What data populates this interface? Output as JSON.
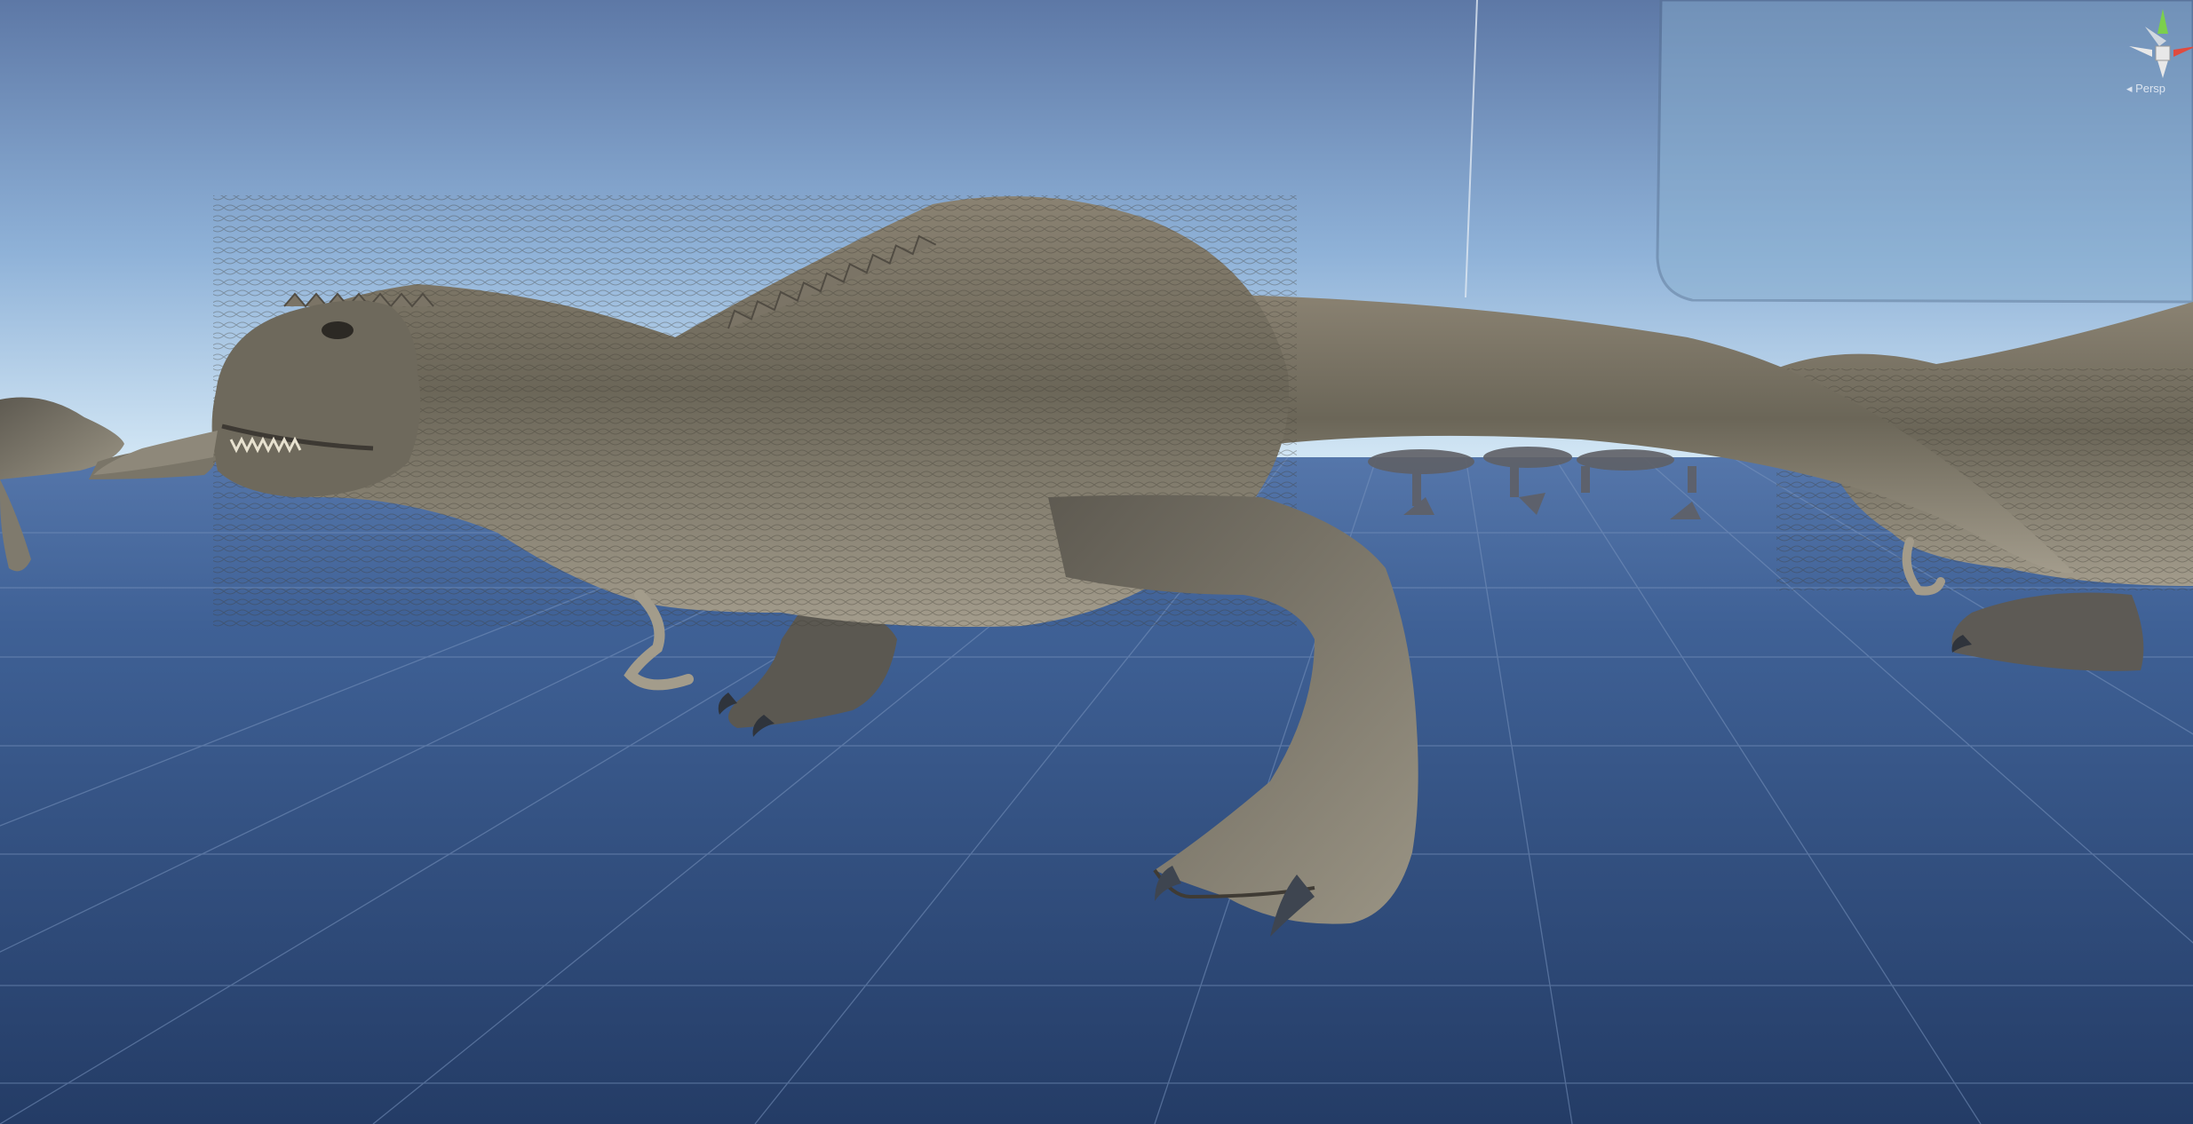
{
  "scene": {
    "view_mode_label": "Persp",
    "gizmo_axes": [
      "y-axis",
      "x-axis",
      "z-axis"
    ],
    "colors": {
      "sky_top": "#5f7dab",
      "sky_horizon": "#c6dff2",
      "ground_near": "#2b4470",
      "ground_far": "#3d5e93",
      "grid_line": "#6b86b3",
      "gizmo_y": "#7ccf4c",
      "gizmo_x": "#e04b3f",
      "gizmo_center": "#e8e8e8",
      "dinosaur_skin": "#6a6458"
    }
  }
}
